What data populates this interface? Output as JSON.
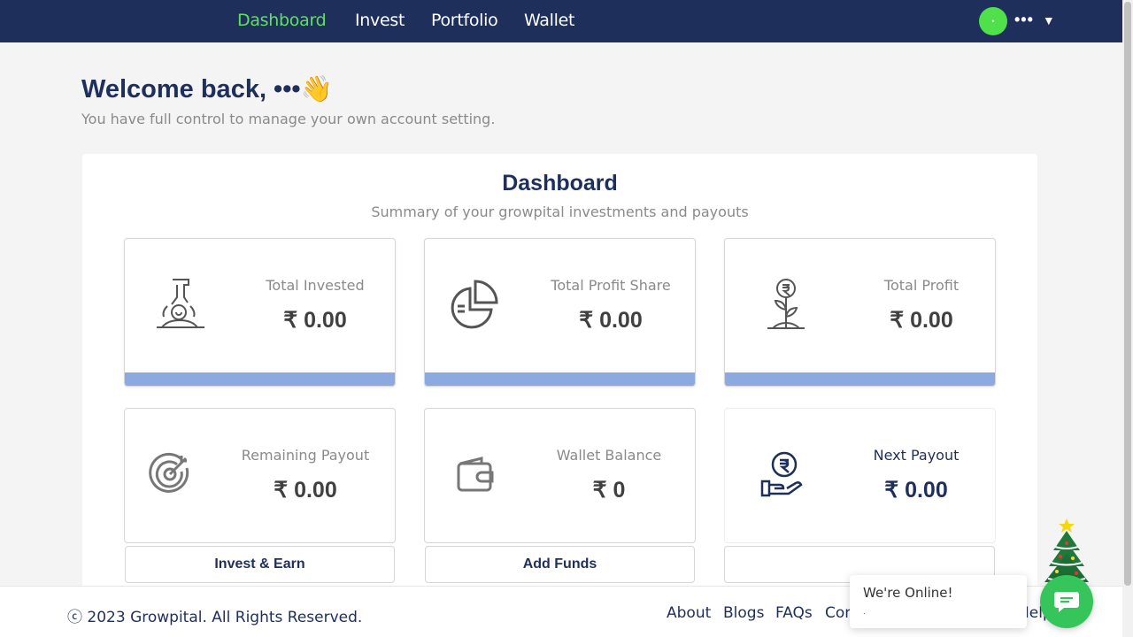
{
  "nav": {
    "items": [
      {
        "label": "Dashboard",
        "active": true
      },
      {
        "label": "Invest",
        "active": false
      },
      {
        "label": "Portfolio",
        "active": false
      },
      {
        "label": "Wallet",
        "active": false
      }
    ],
    "user_name": "•••",
    "avatar_initial": "•"
  },
  "header": {
    "welcome": "Welcome back, •••👋",
    "subtitle": "You have full control to manage your own account setting."
  },
  "dashboard": {
    "title": "Dashboard",
    "subtitle": "Summary of your growpital investments and payouts",
    "cards": [
      {
        "label": "Total Invested",
        "value": "₹ 0.00",
        "icon": "investment-plant-icon"
      },
      {
        "label": "Total Profit Share",
        "value": "₹ 0.00",
        "icon": "pie-chart-icon"
      },
      {
        "label": "Total Profit",
        "value": "₹ 0.00",
        "icon": "rupee-plant-icon"
      },
      {
        "label": "Remaining Payout",
        "value": "₹ 0.00",
        "icon": "target-icon"
      },
      {
        "label": "Wallet Balance",
        "value": "₹ 0",
        "icon": "wallet-icon"
      },
      {
        "label": "Next Payout",
        "value": "₹ 0.00",
        "icon": "hand-coin-icon"
      }
    ],
    "actions": [
      "Invest & Earn",
      "Add Funds",
      ""
    ]
  },
  "footer": {
    "copyright": "ⓒ 2023 Growpital. All Rights Reserved.",
    "links": [
      "About",
      "Blogs",
      "FAQs",
      "Con",
      "Help"
    ]
  },
  "chat": {
    "title": "We're Online!",
    "subtitle": "."
  },
  "colors": {
    "navy": "#1e2f5c",
    "active_nav": "#5fe05f",
    "card_bar": "#8caae0",
    "chat_green": "#35c55b"
  }
}
